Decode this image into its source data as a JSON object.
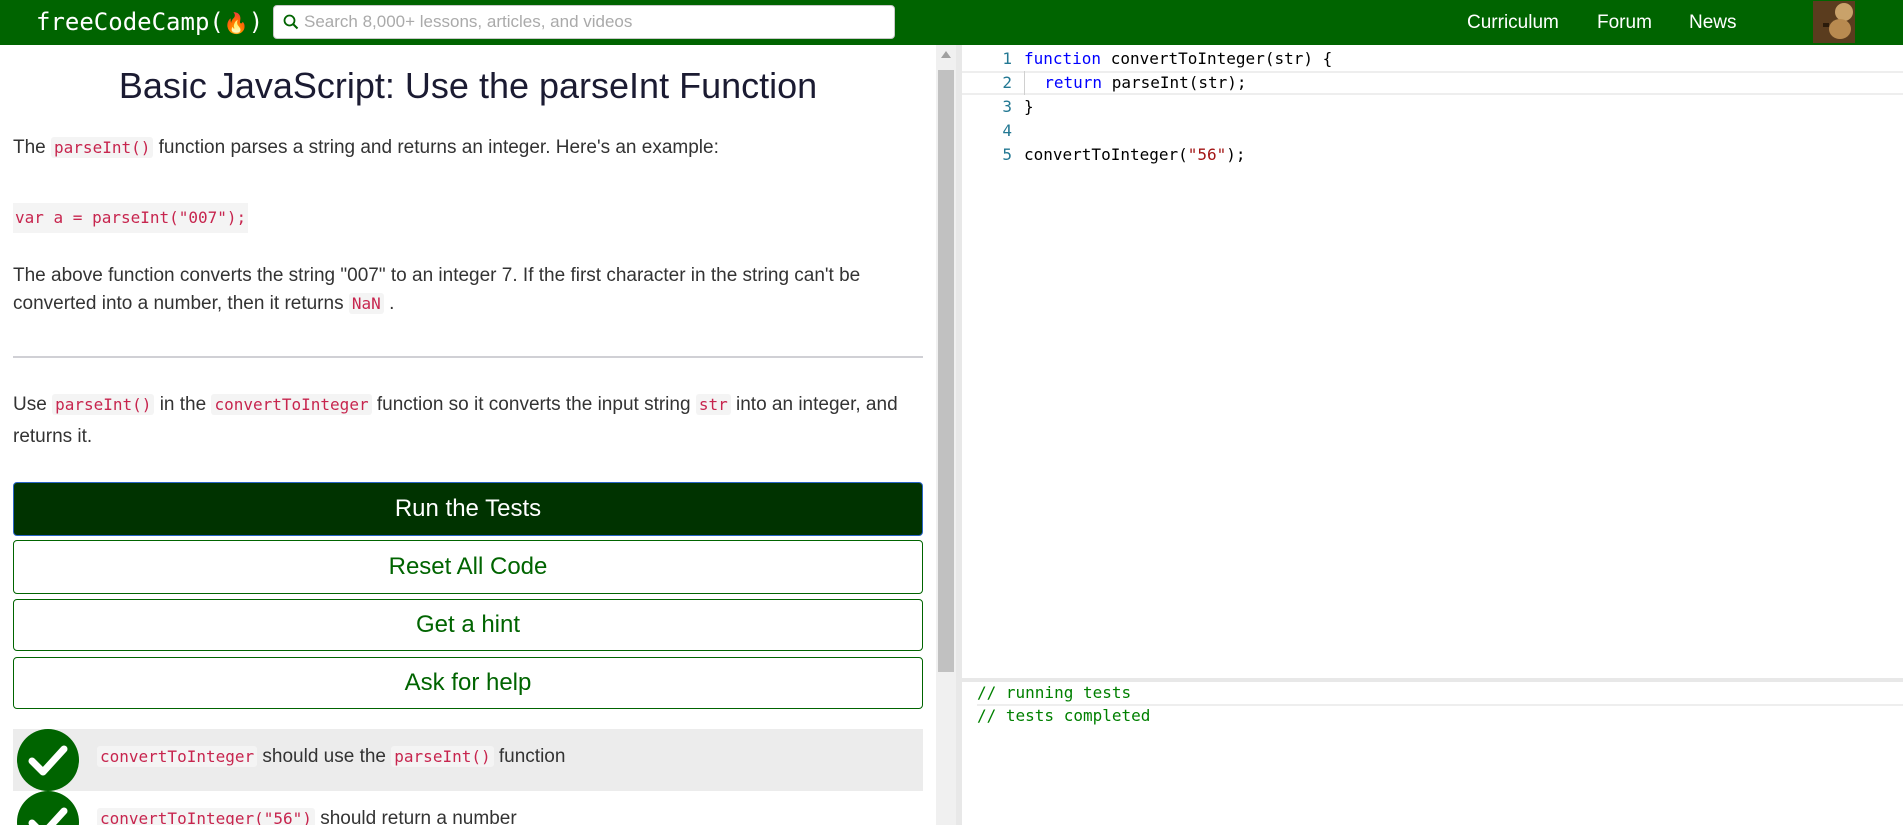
{
  "nav": {
    "logo_text": "freeCodeCamp(",
    "logo_flame": "🔥",
    "logo_close": ")",
    "search_placeholder": "Search 8,000+ lessons, articles, and videos",
    "links": [
      "Curriculum",
      "Forum",
      "News"
    ],
    "brand_color": "#006400"
  },
  "challenge": {
    "title": "Basic JavaScript: Use the parseInt Function",
    "p1": {
      "before": "The",
      "code": "parseInt()",
      "after": "function parses a string and returns an integer. Here's an example:"
    },
    "example_code": "var a = parseInt(\"007\");",
    "p2": {
      "text": "The above function converts the string \"007\" to an integer 7. If the first character in the string can't be converted into a number, then it returns",
      "code": "NaN",
      "end": "."
    },
    "p3": {
      "t1": "Use",
      "c1": "parseInt()",
      "t2": "in the",
      "c2": "convertToInteger",
      "t3": "function so it converts the input string",
      "c3": "str",
      "t4": "into an integer, and returns it."
    }
  },
  "buttons": {
    "run": "Run the Tests",
    "reset": "Reset All Code",
    "hint": "Get a hint",
    "help": "Ask for help"
  },
  "tests": [
    {
      "c1": "convertToInteger",
      "t1": "should use the",
      "c2": "parseInt()",
      "t2": "function",
      "passed": true
    },
    {
      "c1": "convertToInteger(\"56\")",
      "t1": "should return a number",
      "passed": true
    }
  ],
  "editor": {
    "lines": [
      {
        "num": "1",
        "kw": "function",
        "rest": " convertToInteger(str) {"
      },
      {
        "num": "2",
        "indent": "  ",
        "kw": "return",
        "rest": " parseInt(str);"
      },
      {
        "num": "3",
        "rest": "}"
      },
      {
        "num": "4",
        "rest": ""
      },
      {
        "num": "5",
        "pre": "convertToInteger(",
        "str": "\"56\"",
        "post": ");"
      }
    ]
  },
  "output": {
    "lines": [
      "// running tests",
      "// tests completed"
    ]
  }
}
